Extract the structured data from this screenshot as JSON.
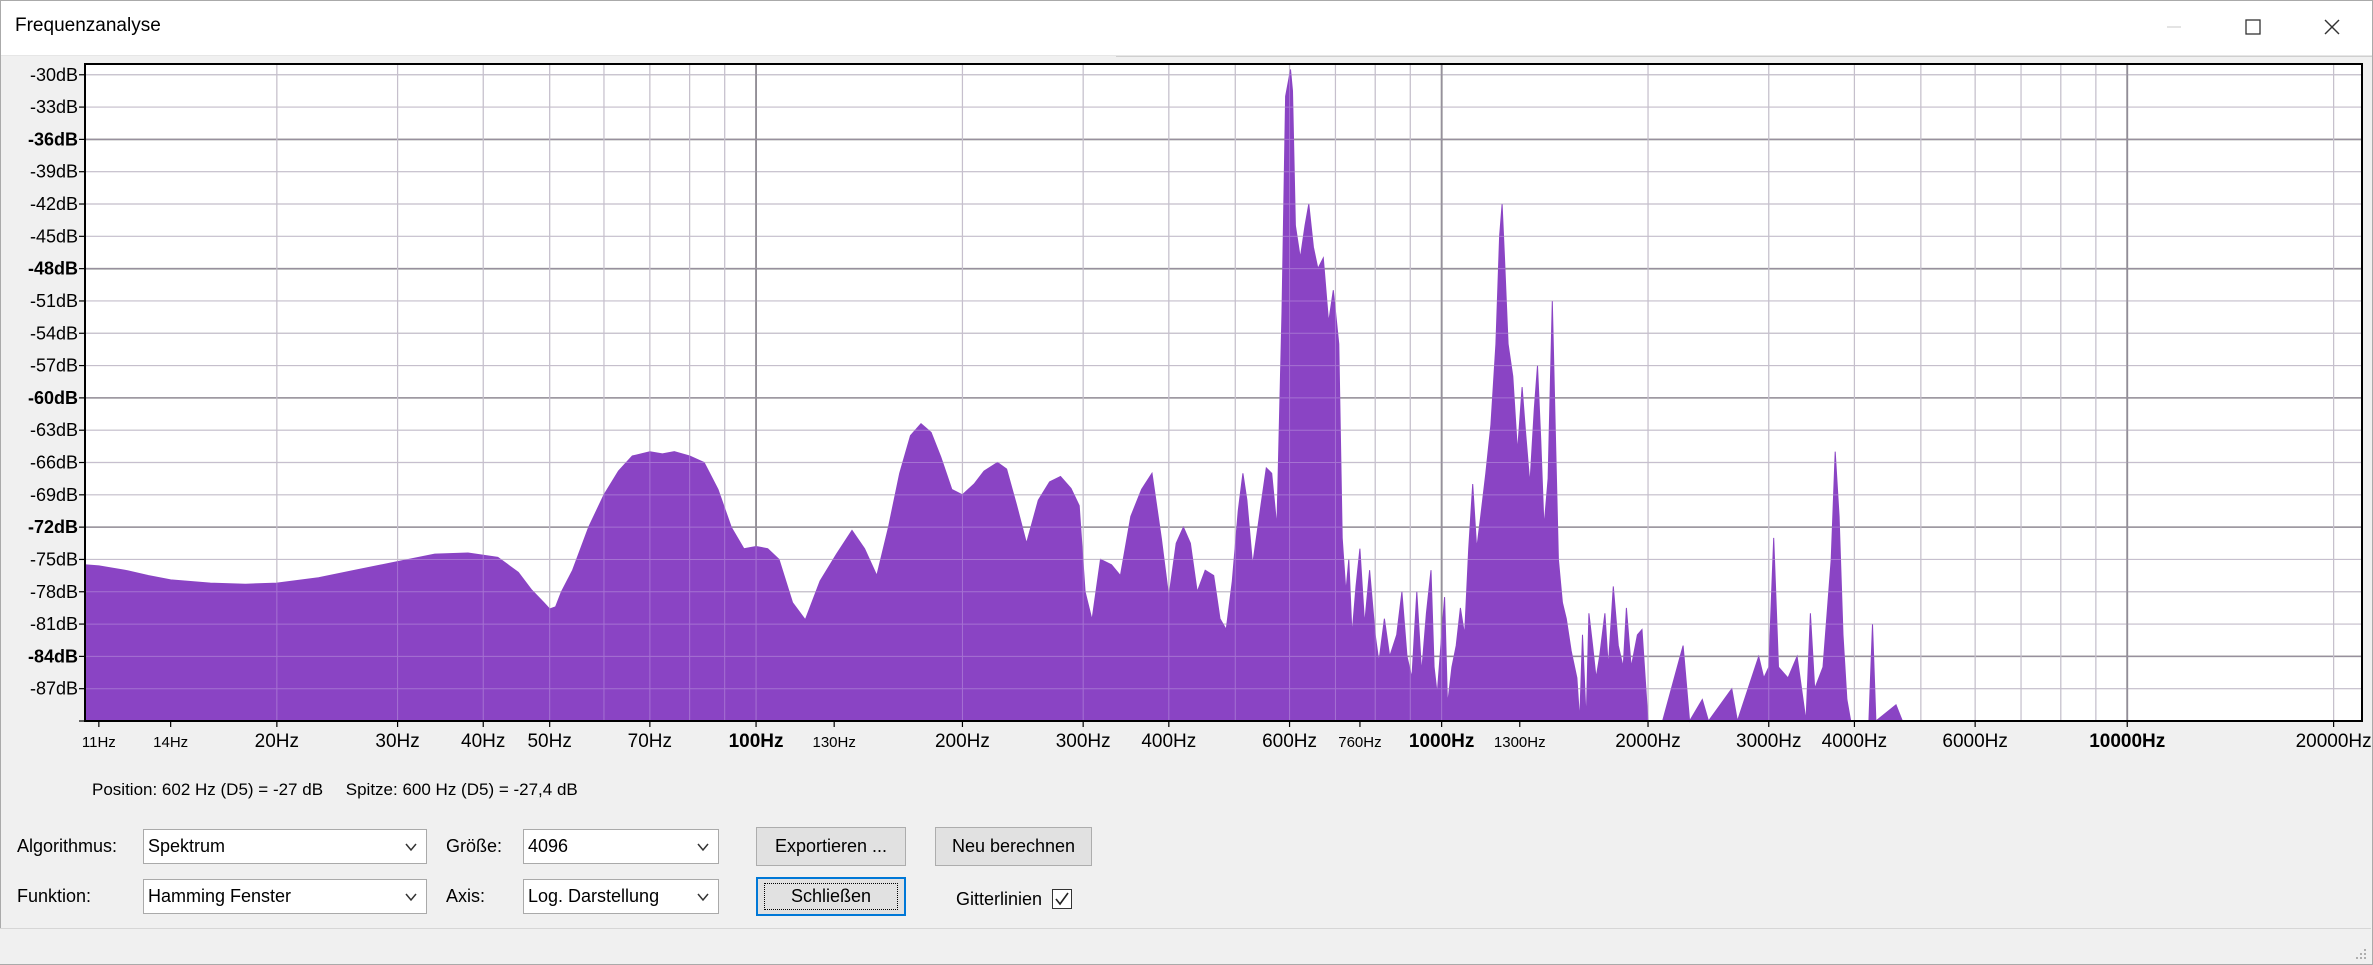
{
  "window": {
    "title": "Frequenzanalyse"
  },
  "chart_data": {
    "type": "area",
    "color": "#8a44c4",
    "x_scale": "log",
    "xlim_hz": [
      10.5,
      22000
    ],
    "ylim_db": [
      -90,
      -29
    ],
    "grid": true,
    "y_ticks": [
      {
        "value": -30,
        "label": "-30dB",
        "bold": false
      },
      {
        "value": -33,
        "label": "-33dB",
        "bold": false
      },
      {
        "value": -36,
        "label": "-36dB",
        "bold": true
      },
      {
        "value": -39,
        "label": "-39dB",
        "bold": false
      },
      {
        "value": -42,
        "label": "-42dB",
        "bold": false
      },
      {
        "value": -45,
        "label": "-45dB",
        "bold": false
      },
      {
        "value": -48,
        "label": "-48dB",
        "bold": true
      },
      {
        "value": -51,
        "label": "-51dB",
        "bold": false
      },
      {
        "value": -54,
        "label": "-54dB",
        "bold": false
      },
      {
        "value": -57,
        "label": "-57dB",
        "bold": false
      },
      {
        "value": -60,
        "label": "-60dB",
        "bold": true
      },
      {
        "value": -63,
        "label": "-63dB",
        "bold": false
      },
      {
        "value": -66,
        "label": "-66dB",
        "bold": false
      },
      {
        "value": -69,
        "label": "-69dB",
        "bold": false
      },
      {
        "value": -72,
        "label": "-72dB",
        "bold": true
      },
      {
        "value": -75,
        "label": "-75dB",
        "bold": false
      },
      {
        "value": -78,
        "label": "-78dB",
        "bold": false
      },
      {
        "value": -81,
        "label": "-81dB",
        "bold": false
      },
      {
        "value": -84,
        "label": "-84dB",
        "bold": true
      },
      {
        "value": -87,
        "label": "-87dB",
        "bold": false
      }
    ],
    "x_ticks": [
      {
        "value": 11,
        "label": "11Hz",
        "size": "small",
        "bold": false
      },
      {
        "value": 14,
        "label": "14Hz",
        "size": "small",
        "bold": false
      },
      {
        "value": 20,
        "label": "20Hz",
        "size": "normal",
        "bold": false
      },
      {
        "value": 30,
        "label": "30Hz",
        "size": "normal",
        "bold": false
      },
      {
        "value": 40,
        "label": "40Hz",
        "size": "normal",
        "bold": false
      },
      {
        "value": 50,
        "label": "50Hz",
        "size": "normal",
        "bold": false
      },
      {
        "value": 70,
        "label": "70Hz",
        "size": "normal",
        "bold": false
      },
      {
        "value": 100,
        "label": "100Hz",
        "size": "normal",
        "bold": true
      },
      {
        "value": 130,
        "label": "130Hz",
        "size": "small",
        "bold": false
      },
      {
        "value": 200,
        "label": "200Hz",
        "size": "normal",
        "bold": false
      },
      {
        "value": 300,
        "label": "300Hz",
        "size": "normal",
        "bold": false
      },
      {
        "value": 400,
        "label": "400Hz",
        "size": "normal",
        "bold": false
      },
      {
        "value": 600,
        "label": "600Hz",
        "size": "normal",
        "bold": false
      },
      {
        "value": 760,
        "label": "760Hz",
        "size": "small",
        "bold": false
      },
      {
        "value": 1000,
        "label": "1000Hz",
        "size": "normal",
        "bold": true
      },
      {
        "value": 1300,
        "label": "1300Hz",
        "size": "small",
        "bold": false
      },
      {
        "value": 2000,
        "label": "2000Hz",
        "size": "normal",
        "bold": false
      },
      {
        "value": 3000,
        "label": "3000Hz",
        "size": "normal",
        "bold": false
      },
      {
        "value": 4000,
        "label": "4000Hz",
        "size": "normal",
        "bold": false
      },
      {
        "value": 6000,
        "label": "6000Hz",
        "size": "normal",
        "bold": false
      },
      {
        "value": 10000,
        "label": "10000Hz",
        "size": "normal",
        "bold": true
      },
      {
        "value": 20000,
        "label": "20000Hz",
        "size": "normal",
        "bold": false
      }
    ],
    "major_x_grid": [
      100,
      1000,
      10000
    ],
    "minor_x_grid": [
      20,
      30,
      40,
      50,
      60,
      70,
      80,
      90,
      200,
      300,
      400,
      500,
      600,
      700,
      800,
      900,
      2000,
      3000,
      4000,
      5000,
      6000,
      7000,
      8000,
      9000,
      20000
    ],
    "spectrum": [
      [
        10.5,
        -75.5
      ],
      [
        11,
        -75.6
      ],
      [
        12,
        -76
      ],
      [
        13,
        -76.5
      ],
      [
        14,
        -76.9
      ],
      [
        16,
        -77.2
      ],
      [
        18,
        -77.3
      ],
      [
        20,
        -77.2
      ],
      [
        23,
        -76.7
      ],
      [
        26,
        -76
      ],
      [
        30,
        -75.2
      ],
      [
        34,
        -74.5
      ],
      [
        38,
        -74.4
      ],
      [
        42,
        -74.8
      ],
      [
        45,
        -76.2
      ],
      [
        47,
        -77.8
      ],
      [
        49,
        -79
      ],
      [
        50,
        -79.6
      ],
      [
        51,
        -79.4
      ],
      [
        52,
        -78
      ],
      [
        54,
        -76
      ],
      [
        57,
        -72
      ],
      [
        60,
        -69
      ],
      [
        63,
        -66.8
      ],
      [
        66,
        -65.4
      ],
      [
        70,
        -65
      ],
      [
        73,
        -65.2
      ],
      [
        76,
        -65
      ],
      [
        80,
        -65.4
      ],
      [
        84,
        -66
      ],
      [
        88,
        -68.5
      ],
      [
        92,
        -72
      ],
      [
        96,
        -74
      ],
      [
        100,
        -73.8
      ],
      [
        104,
        -74
      ],
      [
        108,
        -75
      ],
      [
        113,
        -79
      ],
      [
        118,
        -80.6
      ],
      [
        124,
        -77
      ],
      [
        131,
        -74.5
      ],
      [
        138,
        -72.3
      ],
      [
        144,
        -74
      ],
      [
        150,
        -76.5
      ],
      [
        156,
        -72
      ],
      [
        162,
        -67
      ],
      [
        168,
        -63.5
      ],
      [
        174,
        -62.4
      ],
      [
        180,
        -63.2
      ],
      [
        186,
        -65.5
      ],
      [
        193,
        -68.5
      ],
      [
        200,
        -69
      ],
      [
        208,
        -68
      ],
      [
        215,
        -66.8
      ],
      [
        225,
        -66
      ],
      [
        232,
        -66.6
      ],
      [
        240,
        -70
      ],
      [
        248,
        -73.5
      ],
      [
        258,
        -69.5
      ],
      [
        268,
        -67.8
      ],
      [
        278,
        -67.3
      ],
      [
        288,
        -68.4
      ],
      [
        296,
        -70
      ],
      [
        302,
        -78
      ],
      [
        309,
        -80.6
      ],
      [
        318,
        -75
      ],
      [
        330,
        -75.5
      ],
      [
        340,
        -76.5
      ],
      [
        352,
        -71
      ],
      [
        365,
        -68.5
      ],
      [
        378,
        -67
      ],
      [
        390,
        -73
      ],
      [
        400,
        -78.5
      ],
      [
        410,
        -73.5
      ],
      [
        420,
        -72
      ],
      [
        430,
        -73.5
      ],
      [
        440,
        -78
      ],
      [
        452,
        -76
      ],
      [
        465,
        -76.5
      ],
      [
        475,
        -80.5
      ],
      [
        485,
        -81.5
      ],
      [
        495,
        -77
      ],
      [
        505,
        -70.5
      ],
      [
        513,
        -67
      ],
      [
        520,
        -69.5
      ],
      [
        530,
        -75.5
      ],
      [
        545,
        -70
      ],
      [
        555,
        -66.5
      ],
      [
        565,
        -67
      ],
      [
        575,
        -72
      ],
      [
        585,
        -52
      ],
      [
        592,
        -32
      ],
      [
        598,
        -30.5
      ],
      [
        602,
        -29.5
      ],
      [
        606,
        -31.5
      ],
      [
        612,
        -44
      ],
      [
        622,
        -47
      ],
      [
        632,
        -44
      ],
      [
        640,
        -42
      ],
      [
        650,
        -46
      ],
      [
        660,
        -48
      ],
      [
        672,
        -47
      ],
      [
        684,
        -53
      ],
      [
        695,
        -50
      ],
      [
        708,
        -55
      ],
      [
        716,
        -73
      ],
      [
        725,
        -78
      ],
      [
        732,
        -75
      ],
      [
        740,
        -82
      ],
      [
        750,
        -77.5
      ],
      [
        760,
        -74
      ],
      [
        772,
        -81
      ],
      [
        785,
        -76
      ],
      [
        800,
        -82
      ],
      [
        810,
        -84.5
      ],
      [
        825,
        -80.5
      ],
      [
        840,
        -84
      ],
      [
        860,
        -82
      ],
      [
        875,
        -78
      ],
      [
        890,
        -84
      ],
      [
        905,
        -86
      ],
      [
        920,
        -78
      ],
      [
        935,
        -85.5
      ],
      [
        950,
        -80
      ],
      [
        965,
        -76
      ],
      [
        975,
        -85
      ],
      [
        985,
        -87.5
      ],
      [
        1000,
        -82
      ],
      [
        1010,
        -78.5
      ],
      [
        1020,
        -88.5
      ],
      [
        1035,
        -85
      ],
      [
        1050,
        -83
      ],
      [
        1065,
        -79.5
      ],
      [
        1080,
        -82
      ],
      [
        1095,
        -74
      ],
      [
        1110,
        -68
      ],
      [
        1125,
        -74
      ],
      [
        1140,
        -71
      ],
      [
        1160,
        -67
      ],
      [
        1180,
        -62.5
      ],
      [
        1200,
        -55
      ],
      [
        1215,
        -45
      ],
      [
        1225,
        -42
      ],
      [
        1235,
        -47
      ],
      [
        1250,
        -55
      ],
      [
        1270,
        -58
      ],
      [
        1290,
        -65
      ],
      [
        1310,
        -59
      ],
      [
        1325,
        -63
      ],
      [
        1345,
        -68
      ],
      [
        1365,
        -61
      ],
      [
        1380,
        -57
      ],
      [
        1395,
        -64
      ],
      [
        1410,
        -72
      ],
      [
        1430,
        -67.5
      ],
      [
        1450,
        -51
      ],
      [
        1465,
        -63
      ],
      [
        1480,
        -75
      ],
      [
        1500,
        -79
      ],
      [
        1520,
        -80.5
      ],
      [
        1545,
        -83.5
      ],
      [
        1575,
        -86
      ],
      [
        1590,
        -90
      ],
      [
        1605,
        -82
      ],
      [
        1625,
        -90
      ],
      [
        1640,
        -80
      ],
      [
        1660,
        -83
      ],
      [
        1680,
        -86
      ],
      [
        1700,
        -84
      ],
      [
        1730,
        -80
      ],
      [
        1750,
        -85
      ],
      [
        1780,
        -77.5
      ],
      [
        1810,
        -83
      ],
      [
        1840,
        -85
      ],
      [
        1860,
        -79.5
      ],
      [
        1890,
        -85
      ],
      [
        1930,
        -82
      ],
      [
        1960,
        -81.5
      ],
      [
        2000,
        -90
      ],
      [
        2100,
        -90
      ],
      [
        2250,
        -83
      ],
      [
        2300,
        -90
      ],
      [
        2400,
        -88
      ],
      [
        2450,
        -90
      ],
      [
        2650,
        -87
      ],
      [
        2700,
        -90
      ],
      [
        2900,
        -84
      ],
      [
        2950,
        -86
      ],
      [
        3000,
        -85
      ],
      [
        3050,
        -73
      ],
      [
        3100,
        -85
      ],
      [
        3200,
        -86
      ],
      [
        3300,
        -84
      ],
      [
        3400,
        -90
      ],
      [
        3450,
        -80
      ],
      [
        3500,
        -87
      ],
      [
        3600,
        -85
      ],
      [
        3700,
        -75
      ],
      [
        3750,
        -65
      ],
      [
        3800,
        -71
      ],
      [
        3850,
        -82
      ],
      [
        3900,
        -88
      ],
      [
        3950,
        -90
      ],
      [
        4200,
        -90
      ],
      [
        4250,
        -81
      ],
      [
        4300,
        -90
      ],
      [
        4600,
        -88.5
      ],
      [
        4700,
        -90
      ],
      [
        22000,
        -90
      ]
    ]
  },
  "status": {
    "position_text": "Position: 602 Hz (D5) = -27 dB",
    "peak_text": "Spitze: 600 Hz (D5) = -27,4 dB"
  },
  "controls": {
    "algorithm_label": "Algorithmus:",
    "algorithm_value": "Spektrum",
    "function_label": "Funktion:",
    "function_value": "Hamming Fenster",
    "size_label": "Größe:",
    "size_value": "4096",
    "axis_label": "Axis:",
    "axis_value": "Log. Darstellung",
    "export_button": "Exportieren ...",
    "recalc_button": "Neu berechnen",
    "close_button": "Schließen",
    "grid_label": "Gitterlinien",
    "grid_checked": true
  }
}
